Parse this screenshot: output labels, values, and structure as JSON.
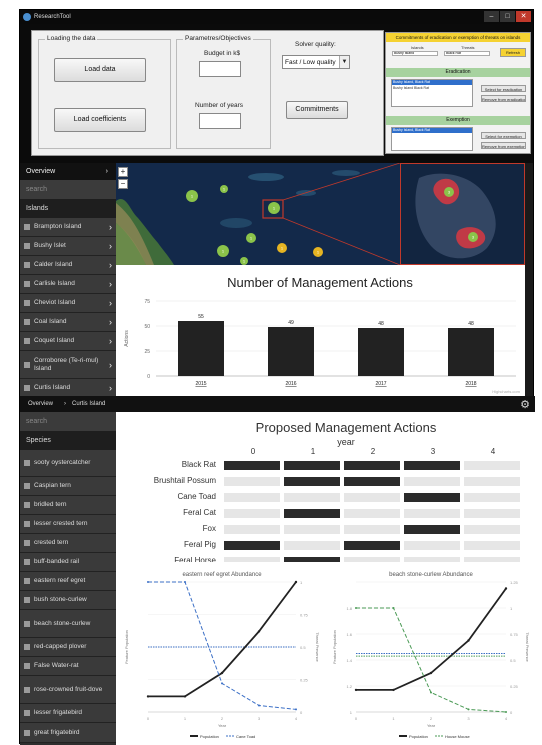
{
  "window": {
    "title": "ResearchTool",
    "buttons": [
      "–",
      "□",
      "✕"
    ]
  },
  "loading": {
    "label": "Loading the data",
    "load_data": "Load data",
    "load_coefficients": "Load coefficients"
  },
  "params": {
    "label": "Parametres/Objectives",
    "budget_label": "Budget in k$",
    "budget_value": "",
    "years_label": "Number of years",
    "years_value": ""
  },
  "solver": {
    "label": "Solver quality:",
    "selected": "Fast / Low quality",
    "commitments": "Commitments"
  },
  "constraints": {
    "title": "Commitments of eradication or exemption of threats on islands",
    "col_island": "Islands",
    "col_threat": "Threats",
    "island_value": "Bushy Island",
    "threat_value": "Black Rat",
    "refresh": "Refresh",
    "eradication_label": "Eradication",
    "eradication_row1": "Bushy Island, Black Rat",
    "eradication_row2": "Bushy Island   Black Rat",
    "select_eradication": "Select for eradication",
    "remove_eradication": "Remove from eradication",
    "exemption_label": "Exemption",
    "exemption_row1": "Bushy Island, Black Rat",
    "select_exemption": "Select for exemption",
    "remove_exemption": "Remove from exemption"
  },
  "nav1": {
    "overview": "Overview",
    "search": "search",
    "section": "Islands",
    "items": [
      "Brampton Island",
      "Bushy Islet",
      "Calder Island",
      "Carlisle Island",
      "Cheviot Island",
      "Coal Island",
      "Coquet Island",
      "Corroboree (Te-ri-mul) Island",
      "Curtis Island"
    ]
  },
  "map": {
    "zoom_in": "+",
    "zoom_out": "−",
    "clusters": [
      "1",
      "1",
      "1",
      "1",
      "1",
      "1",
      "1",
      "1"
    ],
    "inset_clusters": [
      "3",
      "3"
    ]
  },
  "mgmt_chart": {
    "credit": "Highcharts.com"
  },
  "crumbs": {
    "overview": "Overview",
    "island": "Curtis Island"
  },
  "nav2": {
    "search": "search",
    "section": "Species",
    "items": [
      "sooty oystercatcher",
      "Caspian tern",
      "bridled tern",
      "lesser crested tern",
      "crested tern",
      "buff-banded rail",
      "eastern reef egret",
      "bush stone-curlew",
      "beach stone-curlew",
      "red-capped plover",
      "False Water-rat",
      "rose-crowned fruit-dove",
      "lesser frigatebird",
      "great frigatebird"
    ]
  },
  "chart_data": [
    {
      "type": "bar",
      "title": "Number of Management Actions",
      "categories": [
        "2015",
        "2016",
        "2017",
        "2018"
      ],
      "values": [
        55,
        49,
        48,
        48
      ],
      "ylabel": "Actions",
      "yticks": [
        0,
        25,
        50,
        75
      ],
      "ylim": [
        0,
        75
      ]
    },
    {
      "type": "heatmap",
      "title": "Proposed Management Actions",
      "xlabel": "year",
      "columns": [
        "0",
        "1",
        "2",
        "3",
        "4"
      ],
      "rows": [
        "Black Rat",
        "Brushtail Possum",
        "Cane Toad",
        "Feral Cat",
        "Fox",
        "Feral Pig",
        "Feral Horse"
      ],
      "active": [
        [
          1,
          1,
          1,
          1,
          0
        ],
        [
          0,
          1,
          1,
          0,
          0
        ],
        [
          0,
          0,
          0,
          1,
          0
        ],
        [
          0,
          1,
          0,
          0,
          0
        ],
        [
          0,
          0,
          0,
          1,
          0
        ],
        [
          1,
          0,
          1,
          0,
          0
        ],
        [
          0,
          1,
          0,
          0,
          0
        ]
      ],
      "colors": {
        "active": "#2b2b2b",
        "inactive": "#e6e6e6"
      }
    },
    {
      "type": "line",
      "title": "eastern reef egret Abundance",
      "xlabel": "Year",
      "ylabel": "Feature Population",
      "y2label": "Threat Presence",
      "x": [
        0,
        1,
        2,
        3,
        4
      ],
      "xticks": [
        "0",
        "1",
        "2",
        "3",
        "4"
      ],
      "y2ticks": [
        "0",
        "0.25",
        "0.5",
        "0.75",
        "1"
      ],
      "series": [
        {
          "name": "Population",
          "values": [
            0.12,
            0.12,
            0.3,
            0.62,
            1.0
          ],
          "color": "#222222"
        },
        {
          "name": "Cane Toad",
          "values": [
            1.0,
            1.0,
            0.22,
            0.05,
            0.02
          ],
          "color": "#3b6fc6"
        }
      ],
      "extra_lines": [
        {
          "values": [
            0.5,
            0.5,
            0.5,
            0.5,
            0.5
          ],
          "color": "#3b6fc6"
        }
      ]
    },
    {
      "type": "line",
      "title": "beach stone-curlew Abundance",
      "xlabel": "Year",
      "ylabel": "Feature Population",
      "y2label": "Threat Presence",
      "x": [
        0,
        1,
        2,
        3,
        4
      ],
      "xticks": [
        "0",
        "1",
        "2",
        "3",
        "4"
      ],
      "yticks": [
        "1",
        "1.2",
        "1.4",
        "1.6",
        "1.8"
      ],
      "y2ticks": [
        "0",
        "0.25",
        "0.5",
        "0.75",
        "1",
        "1.25"
      ],
      "series": [
        {
          "name": "Population",
          "values": [
            1.17,
            1.17,
            1.3,
            1.55,
            1.95
          ],
          "color": "#222222"
        },
        {
          "name": "House Mouse",
          "values": [
            1.8,
            1.8,
            1.15,
            1.02,
            1.0
          ],
          "color": "#4a9a55"
        }
      ],
      "extra_lines": [
        {
          "values": [
            1.45,
            1.45,
            1.45,
            1.45,
            1.45
          ],
          "color": "#3b6fc6"
        },
        {
          "values": [
            1.43,
            1.43,
            1.43,
            1.43,
            1.43
          ],
          "color": "#4a9a55"
        }
      ]
    }
  ]
}
